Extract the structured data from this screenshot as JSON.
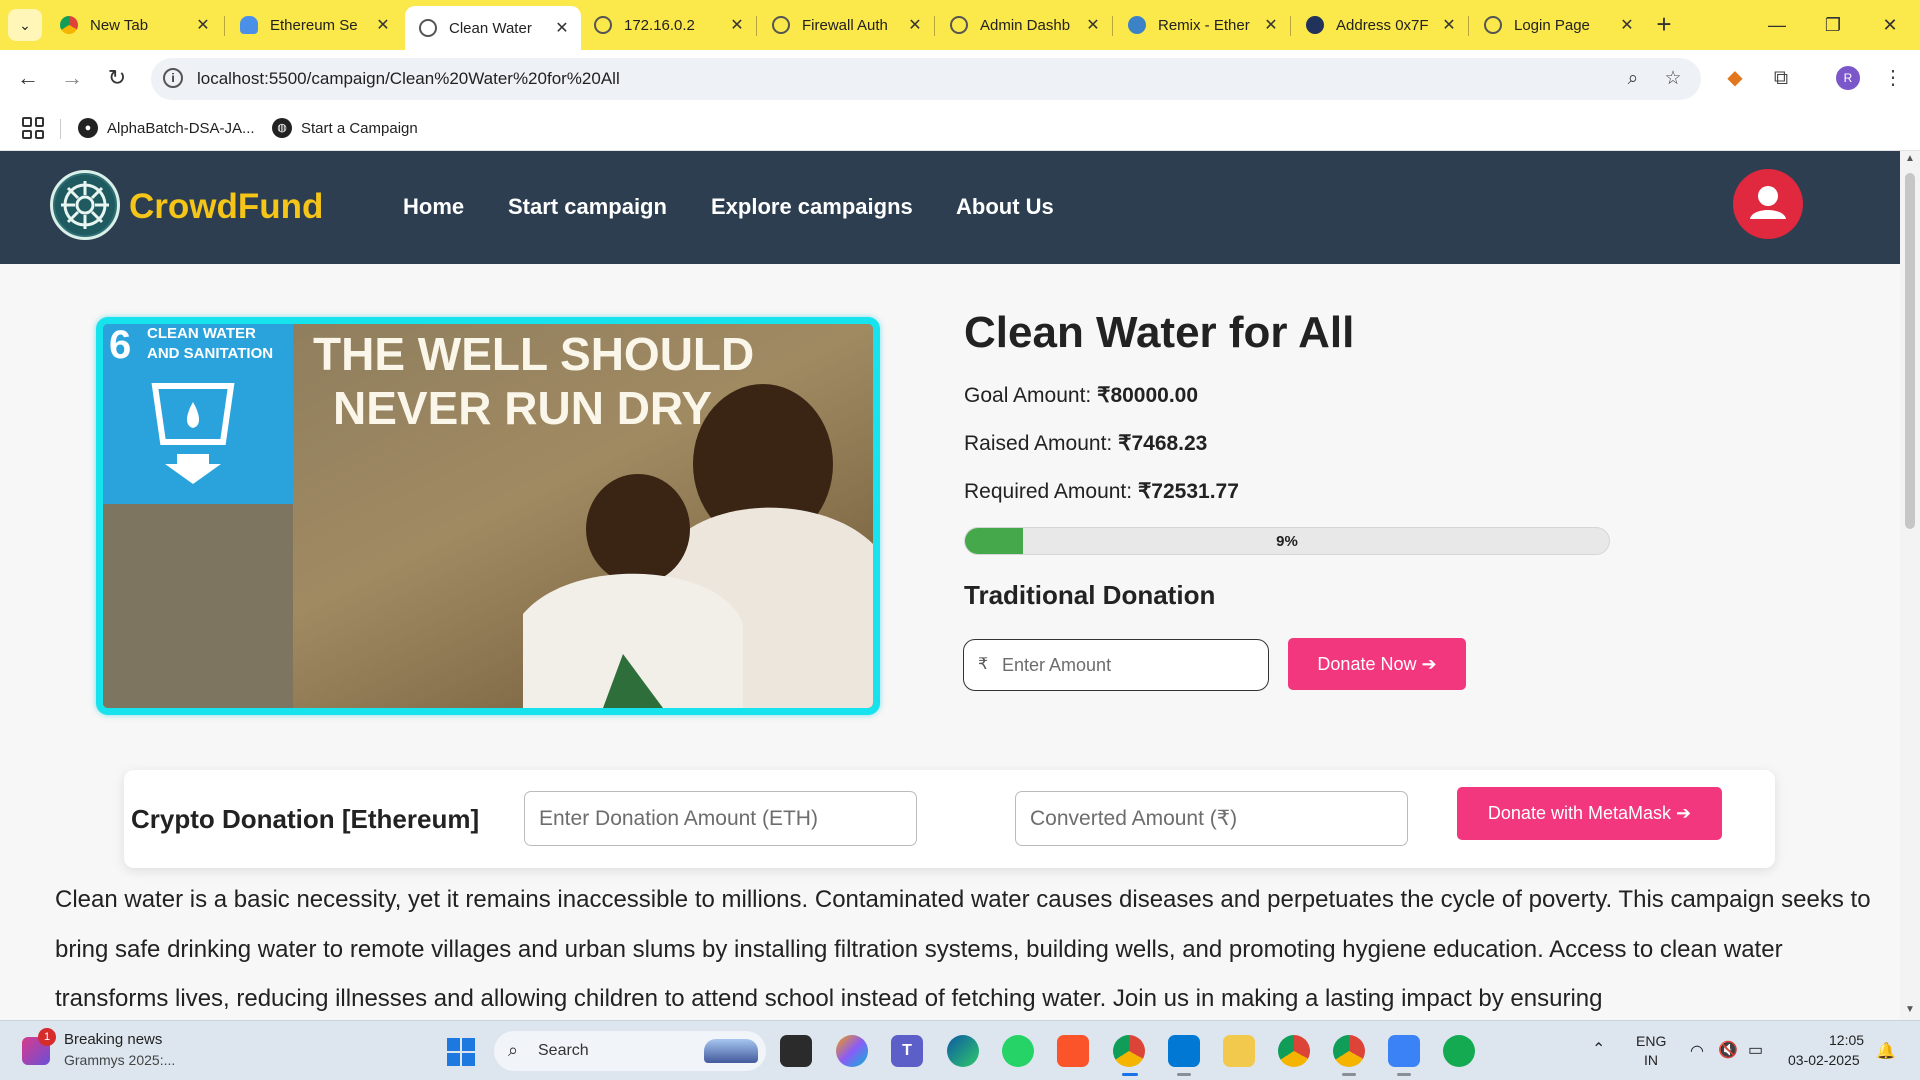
{
  "browser": {
    "tabs": [
      {
        "title": "New Tab",
        "active": false,
        "icon": "chrome-icon"
      },
      {
        "title": "Ethereum Se",
        "active": false,
        "icon": "cloud-icon"
      },
      {
        "title": "Clean Water",
        "active": true,
        "icon": "globe-icon"
      },
      {
        "title": "172.16.0.2",
        "active": false,
        "icon": "globe-icon"
      },
      {
        "title": "Firewall Auth",
        "active": false,
        "icon": "globe-icon"
      },
      {
        "title": "Admin Dashb",
        "active": false,
        "icon": "globe-icon"
      },
      {
        "title": "Remix - Ether",
        "active": false,
        "icon": "remix-icon"
      },
      {
        "title": "Address 0x7F",
        "active": false,
        "icon": "etherscan-icon"
      },
      {
        "title": "Login Page",
        "active": false,
        "icon": "globe-icon"
      }
    ],
    "url": "localhost:5500/campaign/Clean%20Water%20for%20All",
    "bookmarks": [
      {
        "label": "AlphaBatch-DSA-JA..."
      },
      {
        "label": "Start a Campaign"
      }
    ],
    "profile_initial": "R"
  },
  "site": {
    "brand": "CrowdFund",
    "nav": [
      "Home",
      "Start campaign",
      "Explore campaigns",
      "About Us"
    ]
  },
  "campaign": {
    "title": "Clean Water for All",
    "image_text": {
      "goal_number": "6",
      "goal_label_line1": "CLEAN WATER",
      "goal_label_line2": "AND SANITATION",
      "headline_line1": "THE WELL SHOULD",
      "headline_line2": "NEVER RUN DRY"
    },
    "goal_label": "Goal Amount: ",
    "goal_value": "₹80000.00",
    "raised_label": "Raised Amount: ",
    "raised_value": "₹7468.23",
    "required_label": "Required Amount: ",
    "required_value": "₹72531.77",
    "progress_percent": 9,
    "progress_text": "9%",
    "traditional": {
      "title": "Traditional Donation",
      "currency_symbol": "₹",
      "amount_placeholder": "Enter Amount",
      "donate_label": "Donate Now ➔"
    },
    "crypto": {
      "title": "Crypto Donation [Ethereum]",
      "eth_placeholder": "Enter Donation Amount (ETH)",
      "converted_placeholder": "Converted Amount (₹)",
      "donate_label": "Donate with MetaMask ➔"
    },
    "description": "Clean water is a basic necessity, yet it remains inaccessible to millions. Contaminated water causes diseases and perpetuates the cycle of poverty. This campaign seeks to bring safe drinking water to remote villages and urban slums by installing filtration systems, building wells, and promoting hygiene education. Access to clean water transforms lives, reducing illnesses and allowing children to attend school instead of fetching water. Join us in making a lasting impact by ensuring"
  },
  "taskbar": {
    "news_title": "Breaking news",
    "news_sub": "Grammys 2025:...",
    "news_badge": "1",
    "search_label": "Search",
    "lang_line1": "ENG",
    "lang_line2": "IN",
    "time": "12:05",
    "date": "03-02-2025"
  },
  "colors": {
    "tabstrip": "#fbe84a",
    "header": "#2c3e50",
    "brand": "#f5c518",
    "accent_pink": "#f2377e",
    "progress_green": "#45a84a",
    "image_border": "#16e3ee"
  }
}
